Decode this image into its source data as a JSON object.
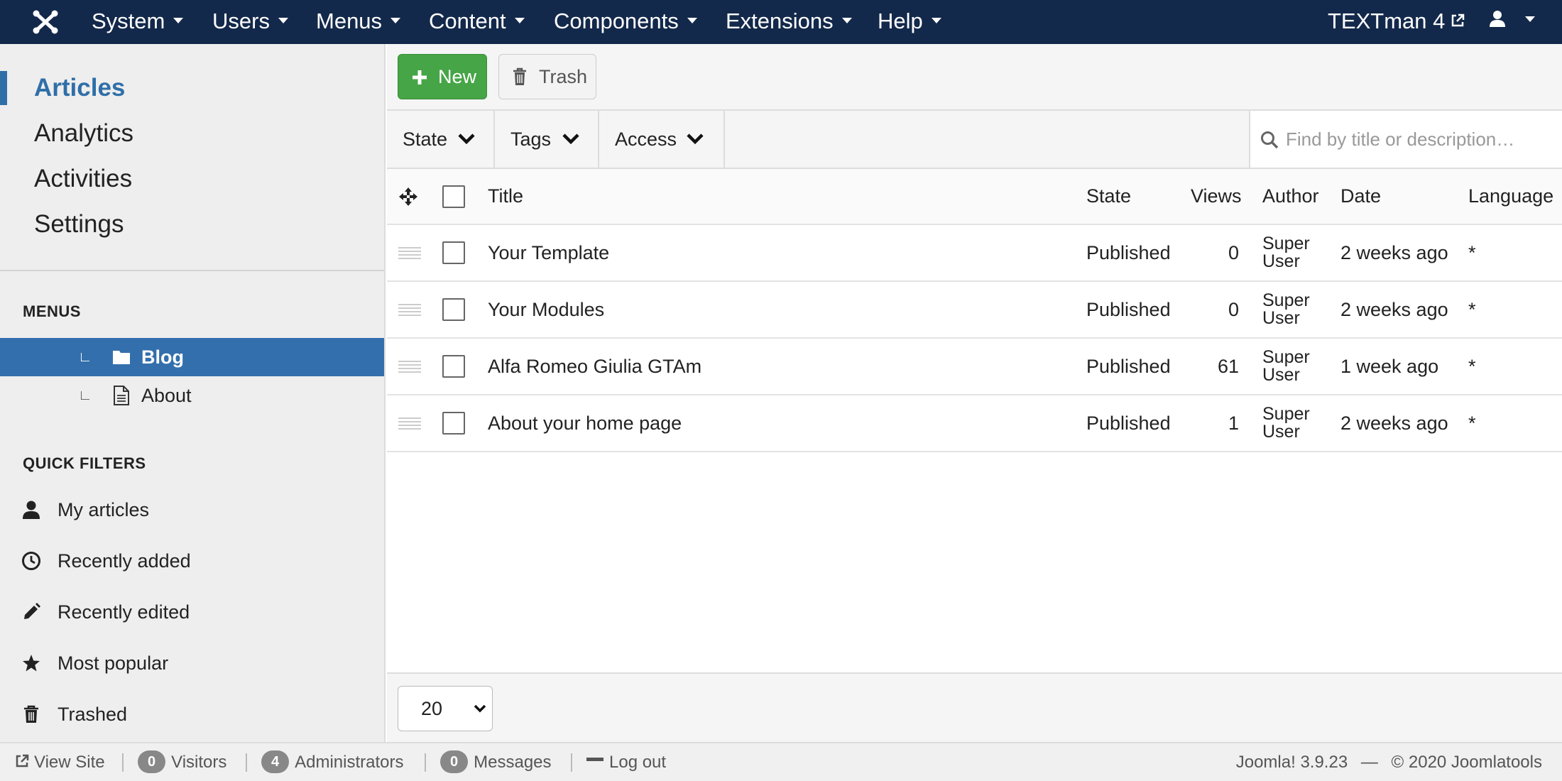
{
  "topbar": {
    "menu": [
      "System",
      "Users",
      "Menus",
      "Content",
      "Components",
      "Extensions",
      "Help"
    ],
    "site_name": "TEXTman 4",
    "bg_color": "#13294b"
  },
  "sidebar": {
    "nav": [
      "Articles",
      "Analytics",
      "Activities",
      "Settings"
    ],
    "menus_heading": "MENUS",
    "menu_tree": [
      {
        "label": "Blog",
        "icon": "folder-icon"
      },
      {
        "label": "About",
        "icon": "document-icon"
      }
    ],
    "quick_filters_heading": "QUICK FILTERS",
    "quick_filters": [
      {
        "label": "My articles",
        "icon": "user-icon"
      },
      {
        "label": "Recently added",
        "icon": "clock-icon"
      },
      {
        "label": "Recently edited",
        "icon": "pencil-icon"
      },
      {
        "label": "Most popular",
        "icon": "star-icon"
      },
      {
        "label": "Trashed",
        "icon": "trash-icon"
      }
    ]
  },
  "toolbar": {
    "new_label": "New",
    "trash_label": "Trash",
    "new_color": "#46a546"
  },
  "filters": {
    "state_label": "State",
    "tags_label": "Tags",
    "access_label": "Access",
    "search_placeholder": "Find by title or description…"
  },
  "table": {
    "headers": {
      "title": "Title",
      "state": "State",
      "views": "Views",
      "author": "Author",
      "date": "Date",
      "language": "Language"
    },
    "rows": [
      {
        "title": "Your Template",
        "state": "Published",
        "views": "0",
        "author": "Super User",
        "date": "2 weeks ago",
        "language": "*"
      },
      {
        "title": "Your Modules",
        "state": "Published",
        "views": "0",
        "author": "Super User",
        "date": "2 weeks ago",
        "language": "*"
      },
      {
        "title": "Alfa Romeo Giulia GTAm",
        "state": "Published",
        "views": "61",
        "author": "Super User",
        "date": "1 week ago",
        "language": "*"
      },
      {
        "title": "About your home page",
        "state": "Published",
        "views": "1",
        "author": "Super User",
        "date": "2 weeks ago",
        "language": "*"
      }
    ]
  },
  "pagination": {
    "limit": "20"
  },
  "statusbar": {
    "view_site": "View Site",
    "visitors_count": "0",
    "visitors_label": "Visitors",
    "admins_count": "4",
    "admins_label": "Administrators",
    "messages_count": "0",
    "messages_label": "Messages",
    "logout": "Log out",
    "version": "Joomla! 3.9.23",
    "dash": "—",
    "copyright": "© 2020 Joomlatools"
  },
  "accent_color": "#336fac"
}
